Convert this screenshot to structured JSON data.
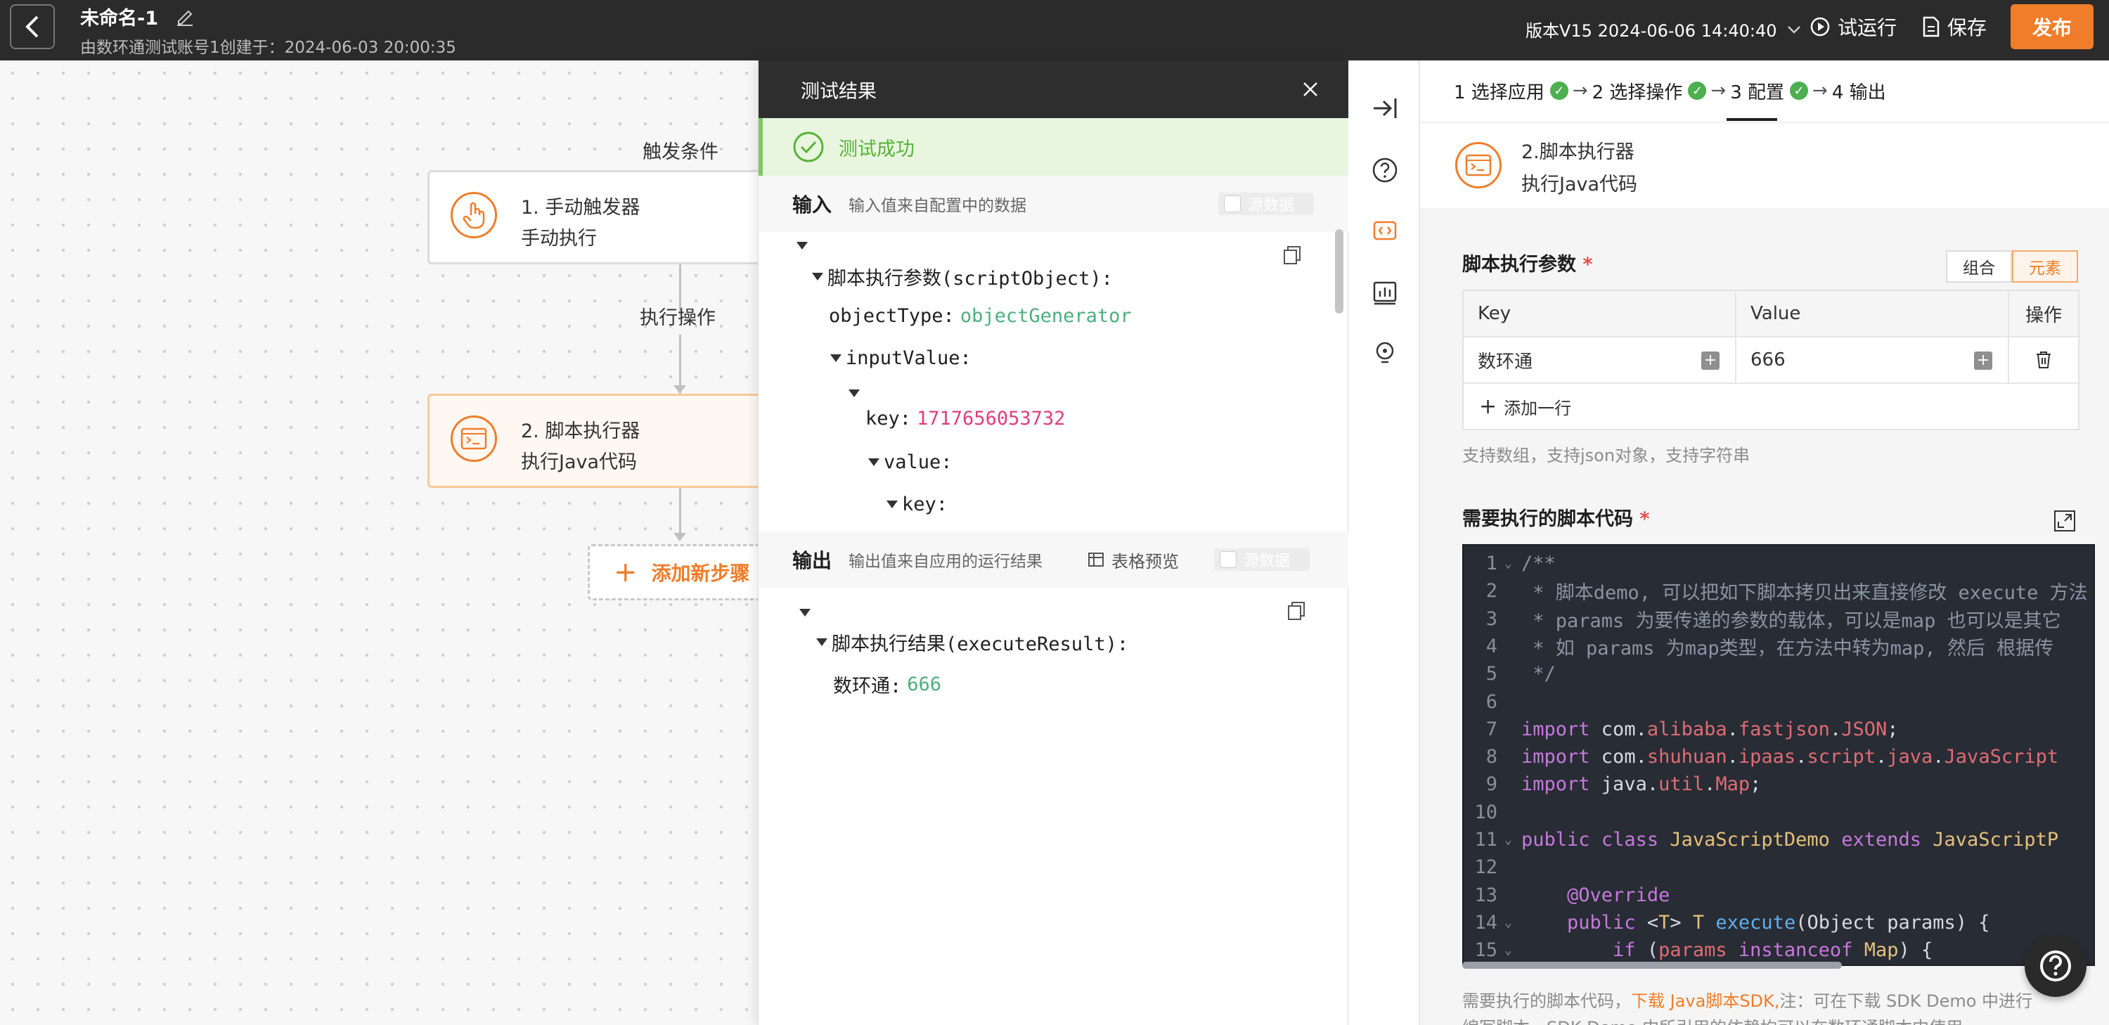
{
  "topbar": {
    "title": "未命名-1",
    "subtitle": "由数环通测试账号1创建于：2024-06-03 20:00:35",
    "version": "版本V15 2024-06-06 14:40:40",
    "trial_run": "试运行",
    "save": "保存",
    "publish": "发布"
  },
  "canvas": {
    "trigger_label": "触发条件",
    "action_label": "执行操作",
    "node1": {
      "title": "1. 手动触发器",
      "desc": "手动执行"
    },
    "node2": {
      "title": "2. 脚本执行器",
      "desc": "执行Java代码"
    },
    "add_step": "添加新步骤"
  },
  "result_panel": {
    "title": "测试结果",
    "status": "测试成功",
    "input": {
      "title": "输入",
      "desc": "输入值来自配置中的数据",
      "toggle_label": "源数据",
      "tree": {
        "root_key": "脚本执行参数(scriptObject):",
        "object_type_key": "objectType:",
        "object_type_val": "objectGenerator",
        "input_value_key": "inputValue:",
        "key_key": "key:",
        "key_val": "1717656053732",
        "value_key": "value:",
        "inner_key": "key:"
      }
    },
    "output": {
      "title": "输出",
      "desc": "输出值来自应用的运行结果",
      "table_preview": "表格预览",
      "toggle_label": "源数据",
      "tree": {
        "root_key": "脚本执行结果(executeResult):",
        "item_key": "数环通:",
        "item_val": "666"
      }
    }
  },
  "config": {
    "steps": [
      {
        "label": "1 选择应用",
        "done": true
      },
      {
        "label": "2 选择操作",
        "done": true
      },
      {
        "label": "3 配置",
        "done": true
      },
      {
        "label": "4 输出",
        "done": false
      }
    ],
    "node_title": "2.脚本执行器",
    "node_desc": "执行Java代码",
    "params_label": "脚本执行参数",
    "required_mark": "*",
    "seg_combine": "组合",
    "seg_element": "元素",
    "table_headers": {
      "key": "Key",
      "value": "Value",
      "op": "操作"
    },
    "table_rows": [
      {
        "key": "数环通",
        "value": "666"
      }
    ],
    "add_row": "添加一行",
    "params_hint": "支持数组，支持json对象，支持字符串",
    "code_label": "需要执行的脚本代码",
    "code_hint_pre": "需要执行的脚本代码，",
    "code_hint_link": "下载 Java脚本SDK,",
    "code_hint_post": "注：可在下载 SDK Demo 中进行",
    "code_hint_line2": "编写脚本，SDK Demo 中所引用的依赖均可以在数环通脚本中使用"
  },
  "code_lines": [
    {
      "n": "1",
      "fold": true,
      "html": "<span class=\"cm\">/**</span>"
    },
    {
      "n": "2",
      "fold": false,
      "html": "<span class=\"cm\"> * 脚本demo, 可以把如下脚本拷贝出来直接修改 execute 方法</span>"
    },
    {
      "n": "3",
      "fold": false,
      "html": "<span class=\"cm\"> * params 为要传递的参数的载体，可以是map 也可以是其它</span>"
    },
    {
      "n": "4",
      "fold": false,
      "html": "<span class=\"cm\"> * 如 params 为map类型，在方法中转为map, 然后 根据传</span>"
    },
    {
      "n": "5",
      "fold": false,
      "html": "<span class=\"cm\"> */</span>"
    },
    {
      "n": "6",
      "fold": false,
      "html": ""
    },
    {
      "n": "7",
      "fold": false,
      "html": "<span class=\"kw\">import</span> com.<span class=\"pk\">alibaba</span>.<span class=\"pk\">fastjson</span>.<span class=\"pk\">JSON</span>;"
    },
    {
      "n": "8",
      "fold": false,
      "html": "<span class=\"kw\">import</span> com.<span class=\"pk\">shuhuan</span>.<span class=\"pk\">ipaas</span>.<span class=\"pk\">script</span>.<span class=\"pk\">java</span>.<span class=\"pk\">JavaScript</span>"
    },
    {
      "n": "9",
      "fold": false,
      "html": "<span class=\"kw\">import</span> java.<span class=\"pk\">util</span>.<span class=\"pk\">Map</span>;"
    },
    {
      "n": "10",
      "fold": false,
      "html": ""
    },
    {
      "n": "11",
      "fold": true,
      "html": "<span class=\"kw\">public</span> <span class=\"kw\">class</span> <span class=\"cls\">JavaScriptDemo</span> <span class=\"kw\">extends</span> <span class=\"cls\">JavaScriptP</span>"
    },
    {
      "n": "12",
      "fold": false,
      "html": ""
    },
    {
      "n": "13",
      "fold": false,
      "html": "    <span class=\"an\">@Override</span>"
    },
    {
      "n": "14",
      "fold": true,
      "html": "    <span class=\"kw\">public</span> &lt;<span class=\"cls\">T</span>&gt; <span class=\"cls\">T</span> <span class=\"fn\">execute</span>(Object params) {"
    },
    {
      "n": "15",
      "fold": true,
      "html": "        <span class=\"kw\">if</span> (<span class=\"pk\">params</span> <span class=\"kw\">instanceof</span> <span class=\"cls\">Map</span>) {"
    }
  ],
  "colors": {
    "accent": "#f07d2a",
    "success": "#58b337",
    "topbar": "#2b2b2b"
  }
}
